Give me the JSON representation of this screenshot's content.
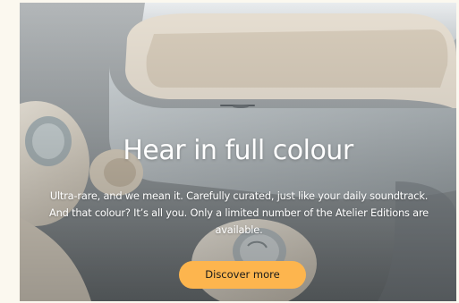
{
  "hero": {
    "headline": "Hear in full colour",
    "body_line1": "Ultra-rare, and we mean it. Carefully curated, just like your daily soundtrack.",
    "body_line2": "And that colour? It’s all you. Only a limited number of the Atelier Editions are",
    "body_line3": "available.",
    "cta_label": "Discover more",
    "image_subject": "earbuds-and-charging-case",
    "colors": {
      "cta_background": "#fdb54e",
      "text": "#ffffff",
      "page_background": "#fbf8ef"
    }
  }
}
